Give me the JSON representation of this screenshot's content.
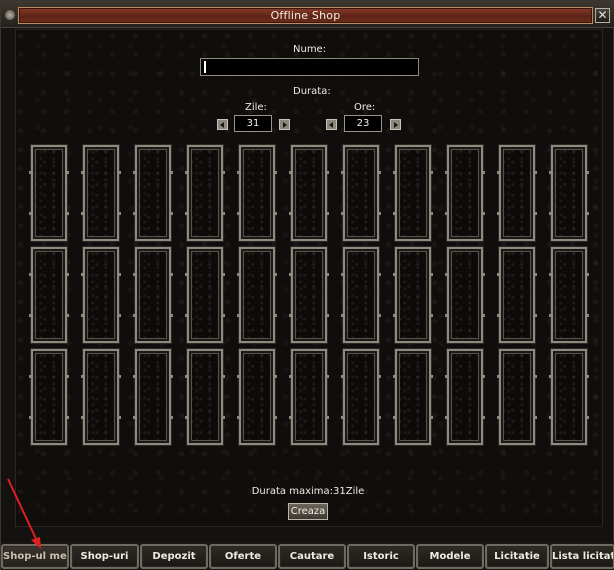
{
  "window": {
    "title": "Offline Shop",
    "close_glyph": "✕"
  },
  "form": {
    "name_label": "Nume:",
    "name_value": "",
    "duration_label": "Durata:",
    "days_label": "Zile:",
    "days_value": "31",
    "hours_label": "Ore:",
    "hours_value": "23"
  },
  "slots": {
    "rows": 3,
    "cols": 11
  },
  "footer": {
    "max_duration": "Durata maxima:31Zile",
    "create_button": "Creaza"
  },
  "tabs": [
    {
      "label": "Shop-ul meu",
      "active": true
    },
    {
      "label": "Shop-uri",
      "active": false
    },
    {
      "label": "Depozit",
      "active": false
    },
    {
      "label": "Oferte",
      "active": false
    },
    {
      "label": "Cautare",
      "active": false
    },
    {
      "label": "Istoric",
      "active": false
    },
    {
      "label": "Modele",
      "active": false
    },
    {
      "label": "Licitatie",
      "active": false
    },
    {
      "label": "Lista licitatie",
      "active": false
    }
  ],
  "colors": {
    "annotation_arrow": "#e02020",
    "title_bar": "#6e2c1c"
  }
}
